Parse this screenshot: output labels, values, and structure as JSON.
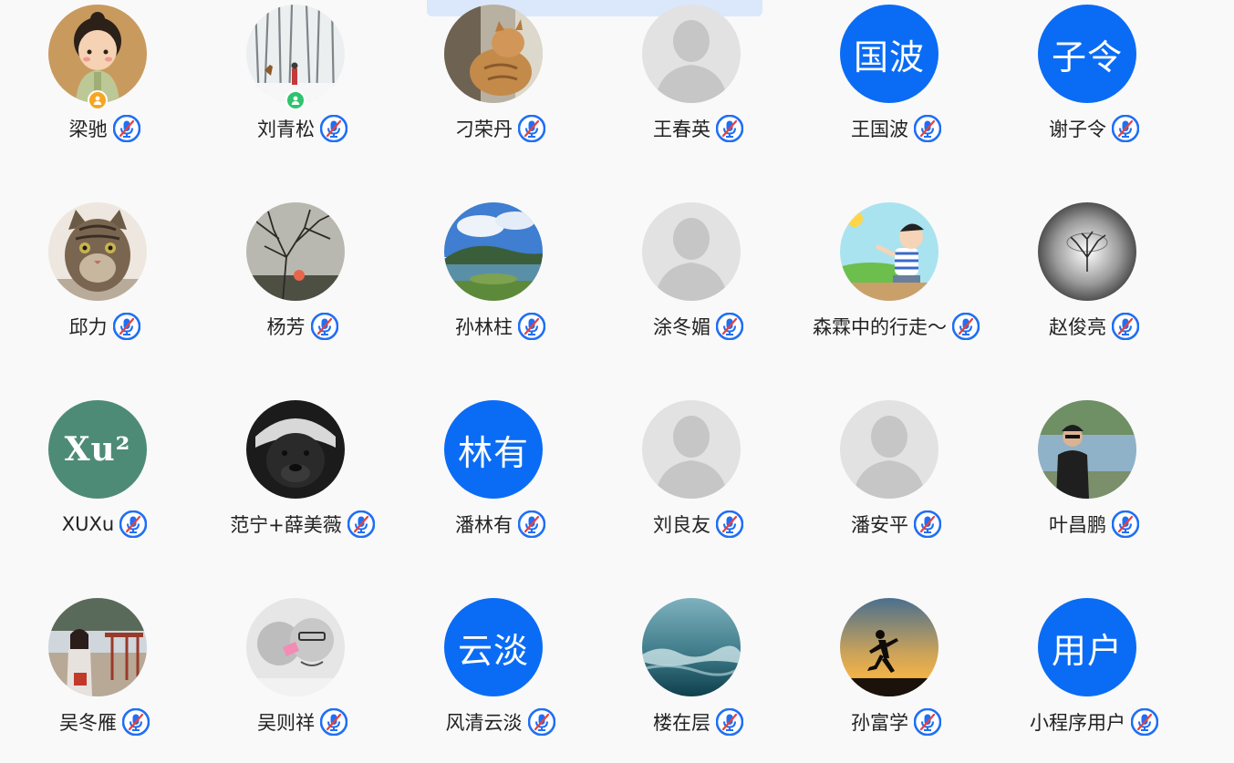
{
  "top_banner": {
    "text": "…  …  …"
  },
  "colors": {
    "background": "#f9f9f9",
    "brand_blue": "#0a6cf5",
    "placeholder_gray": "#e2e2e2",
    "host_badge": "#f5a623",
    "online_badge": "#2fc36d",
    "mic_ring": "#1e6ff5",
    "mic_mute_slash": "#e8413c"
  },
  "participants": [
    {
      "name": "梁驰",
      "avatar": {
        "kind": "photo",
        "icon": "cartoon-girl-photo"
      },
      "badge": "host-badge",
      "mic": "mic-muted-icon"
    },
    {
      "name": "刘青松",
      "avatar": {
        "kind": "photo",
        "icon": "snowy-forest-photo"
      },
      "badge": "online-badge",
      "mic": "mic-muted-icon"
    },
    {
      "name": "刁荣丹",
      "avatar": {
        "kind": "photo",
        "icon": "cat-window-photo"
      },
      "badge": "",
      "mic": "mic-muted-icon"
    },
    {
      "name": "王春英",
      "avatar": {
        "kind": "placeholder",
        "icon": "default-user-icon"
      },
      "badge": "",
      "mic": "mic-muted-icon"
    },
    {
      "name": "王国波",
      "avatar": {
        "kind": "text",
        "text": "国波"
      },
      "badge": "",
      "mic": "mic-muted-icon"
    },
    {
      "name": "谢子令",
      "avatar": {
        "kind": "text",
        "text": "子令"
      },
      "badge": "",
      "mic": "mic-muted-icon"
    },
    {
      "name": "邱力",
      "avatar": {
        "kind": "photo",
        "icon": "tabby-cat-photo"
      },
      "badge": "",
      "mic": "mic-muted-icon"
    },
    {
      "name": "杨芳",
      "avatar": {
        "kind": "photo",
        "icon": "sunset-tree-photo"
      },
      "badge": "",
      "mic": "mic-muted-icon"
    },
    {
      "name": "孙林柱",
      "avatar": {
        "kind": "photo",
        "icon": "lake-landscape-photo"
      },
      "badge": "",
      "mic": "mic-muted-icon"
    },
    {
      "name": "涂冬媚",
      "avatar": {
        "kind": "placeholder",
        "icon": "default-user-icon"
      },
      "badge": "",
      "mic": "mic-muted-icon"
    },
    {
      "name": "森霖中的行走～",
      "avatar": {
        "kind": "photo",
        "icon": "cartoon-boy-photo"
      },
      "badge": "",
      "mic": "mic-muted-icon"
    },
    {
      "name": "赵俊亮",
      "avatar": {
        "kind": "photo",
        "icon": "lone-tree-photo"
      },
      "badge": "",
      "mic": "mic-muted-icon"
    },
    {
      "name": "XUXu",
      "avatar": {
        "kind": "logo",
        "text": "Xu²",
        "color": "#4e8b77"
      },
      "badge": "",
      "mic": "mic-muted-icon"
    },
    {
      "name": "范宁+薛美薇",
      "avatar": {
        "kind": "photo",
        "icon": "honey-badger-photo"
      },
      "badge": "",
      "mic": "mic-muted-icon"
    },
    {
      "name": "潘林有",
      "avatar": {
        "kind": "text",
        "text": "林有"
      },
      "badge": "",
      "mic": "mic-muted-icon"
    },
    {
      "name": "刘良友",
      "avatar": {
        "kind": "placeholder",
        "icon": "default-user-icon"
      },
      "badge": "",
      "mic": "mic-muted-icon"
    },
    {
      "name": "潘安平",
      "avatar": {
        "kind": "placeholder",
        "icon": "default-user-icon"
      },
      "badge": "",
      "mic": "mic-muted-icon"
    },
    {
      "name": "叶昌鹏",
      "avatar": {
        "kind": "photo",
        "icon": "man-by-lake-photo"
      },
      "badge": "",
      "mic": "mic-muted-icon"
    },
    {
      "name": "吴冬雁",
      "avatar": {
        "kind": "photo",
        "icon": "woman-at-temple-photo"
      },
      "badge": "",
      "mic": "mic-muted-icon"
    },
    {
      "name": "吴则祥",
      "avatar": {
        "kind": "photo",
        "icon": "couple-photo"
      },
      "badge": "",
      "mic": "mic-muted-icon"
    },
    {
      "name": "风清云淡",
      "avatar": {
        "kind": "text",
        "text": "云淡"
      },
      "badge": "",
      "mic": "mic-muted-icon"
    },
    {
      "name": "楼在层",
      "avatar": {
        "kind": "photo",
        "icon": "sea-wave-photo"
      },
      "badge": "",
      "mic": "mic-muted-icon"
    },
    {
      "name": "孙富学",
      "avatar": {
        "kind": "photo",
        "icon": "runner-sunset-photo"
      },
      "badge": "",
      "mic": "mic-muted-icon"
    },
    {
      "name": "小程序用户",
      "avatar": {
        "kind": "text",
        "text": "用户"
      },
      "badge": "",
      "mic": "mic-muted-icon"
    }
  ]
}
